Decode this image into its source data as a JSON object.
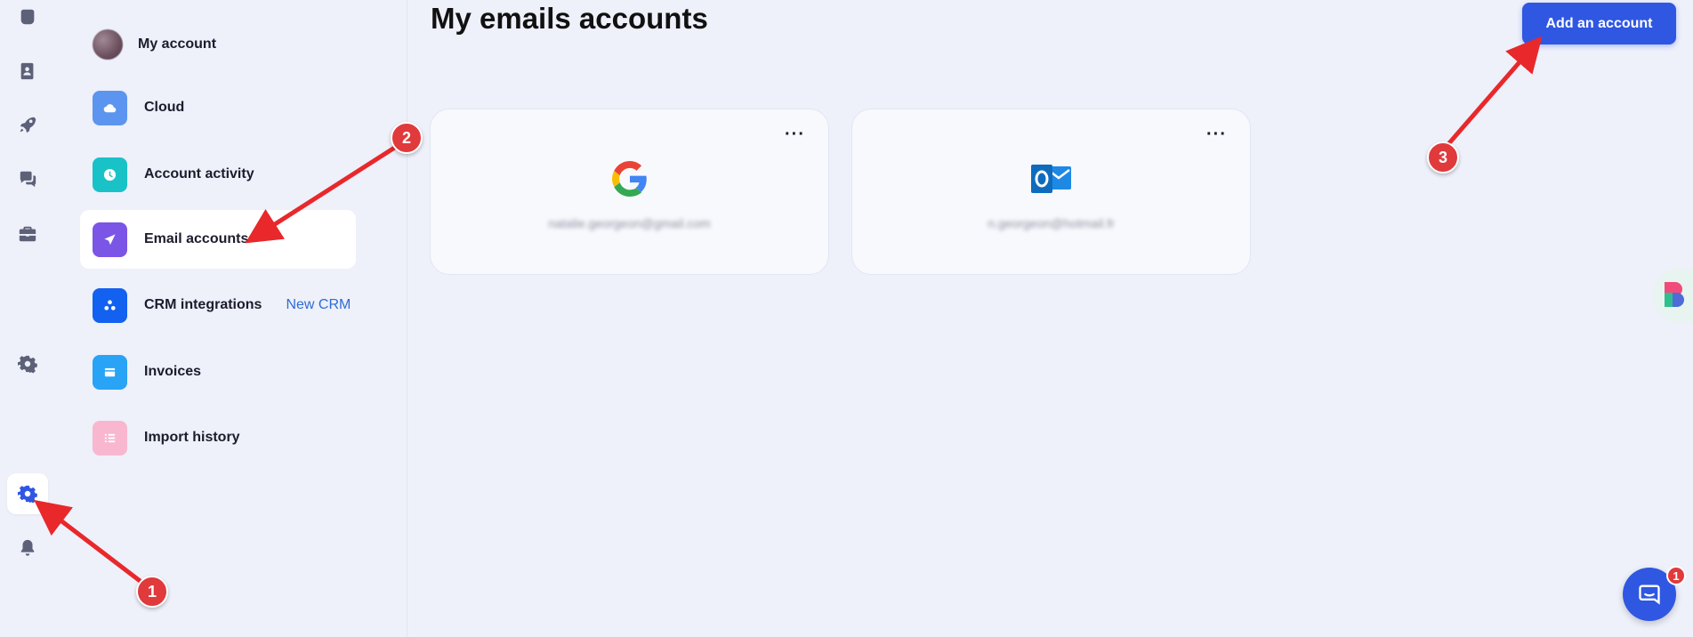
{
  "rail": {
    "items": [
      {
        "icon": "home-icon"
      },
      {
        "icon": "contacts-icon"
      },
      {
        "icon": "rocket-icon"
      },
      {
        "icon": "chat-icon"
      },
      {
        "icon": "briefcase-icon"
      },
      {
        "icon": "gear-icon"
      },
      {
        "icon": "gear-icon",
        "active": true
      },
      {
        "icon": "bell-icon"
      }
    ]
  },
  "menu": {
    "items": [
      {
        "label": "My account",
        "icon": "avatar"
      },
      {
        "label": "Cloud",
        "icon": "cloud-icon",
        "color": "#5b95f0"
      },
      {
        "label": "Account activity",
        "icon": "clock-icon",
        "color": "#19c2c7"
      },
      {
        "label": "Email accounts",
        "icon": "send-icon",
        "color": "#7b55e6",
        "active": true
      },
      {
        "label": "CRM integrations",
        "icon": "crm-icon",
        "color": "#1261f0",
        "badge": "New CRM"
      },
      {
        "label": "Invoices",
        "icon": "card-icon",
        "color": "#28a3f5"
      },
      {
        "label": "Import history",
        "icon": "list-icon",
        "color": "#f8b7cf"
      }
    ]
  },
  "main": {
    "title": "My emails accounts",
    "add_button": "Add an account",
    "accounts": [
      {
        "provider_icon": "google-icon",
        "email": "natalie.georgeon@gmail.com",
        "menu": "···"
      },
      {
        "provider_icon": "outlook-icon",
        "email": "n.georgeon@hotmail.fr",
        "menu": "···"
      }
    ]
  },
  "annotations": {
    "markers": [
      "1",
      "2",
      "3"
    ],
    "color": "#e03a3c"
  },
  "chat": {
    "unread": "1"
  },
  "colors": {
    "accent": "#2f57e2",
    "background": "#eef0fa"
  }
}
